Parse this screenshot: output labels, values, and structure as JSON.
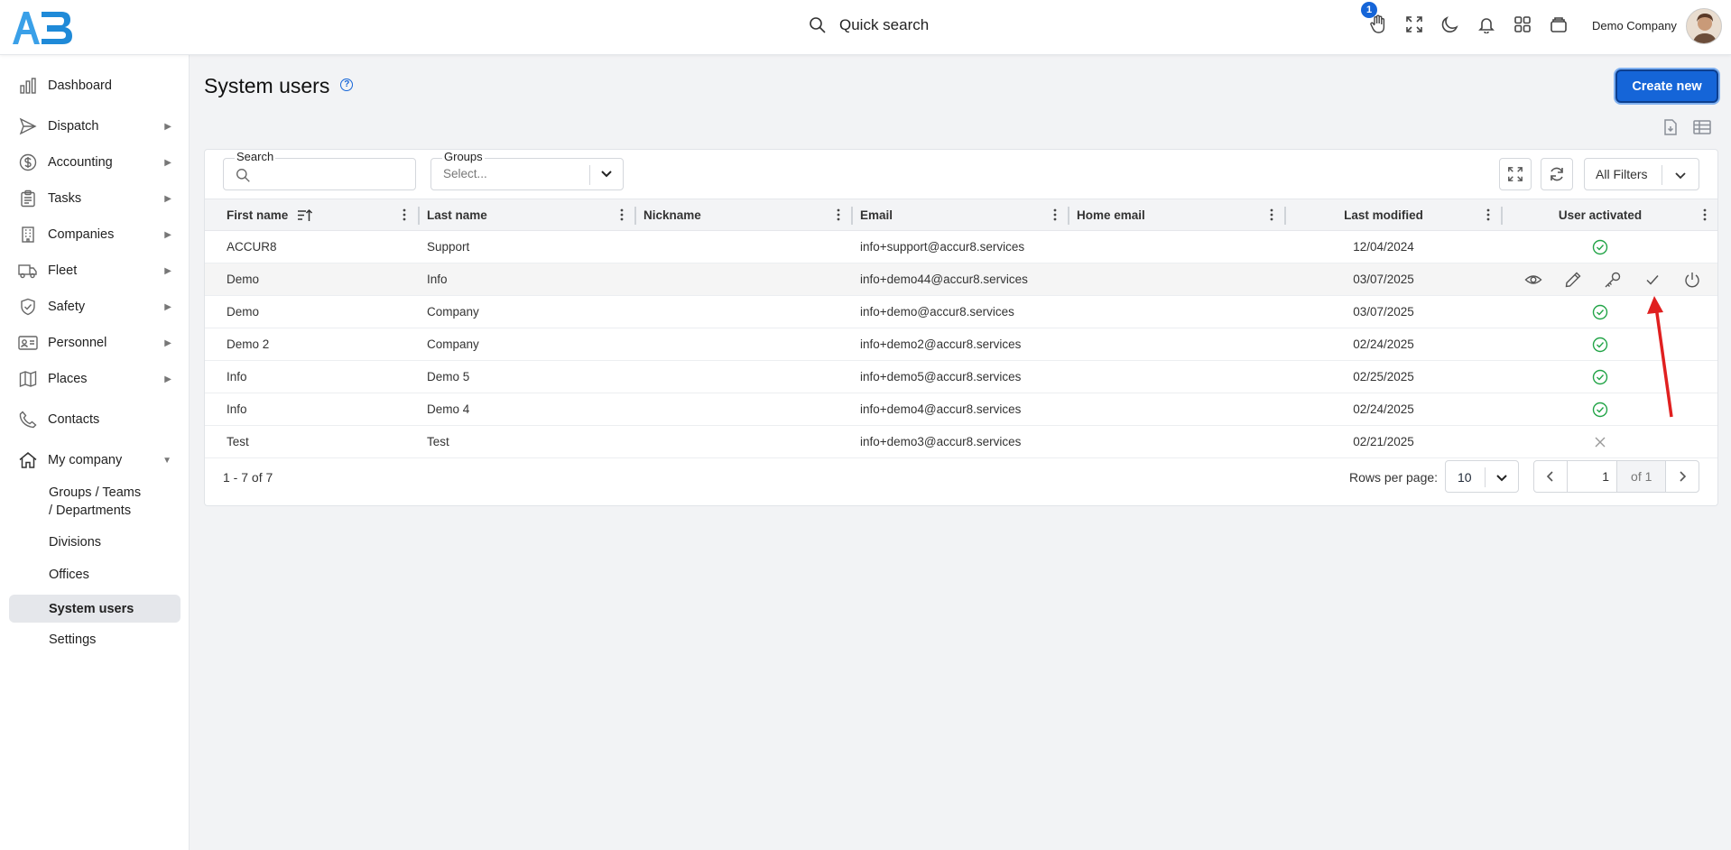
{
  "header": {
    "quick_search": "Quick search",
    "notification_count": "1",
    "company": "Demo Company"
  },
  "sidebar": {
    "items": [
      {
        "label": "Dashboard",
        "icon": "chart-bars-icon",
        "has_arrow": false
      },
      {
        "label": "Dispatch",
        "icon": "send-icon",
        "has_arrow": true
      },
      {
        "label": "Accounting",
        "icon": "dollar-circle-icon",
        "has_arrow": true
      },
      {
        "label": "Tasks",
        "icon": "clipboard-icon",
        "has_arrow": true
      },
      {
        "label": "Companies",
        "icon": "building-icon",
        "has_arrow": true
      },
      {
        "label": "Fleet",
        "icon": "truck-icon",
        "has_arrow": true
      },
      {
        "label": "Safety",
        "icon": "shield-check-icon",
        "has_arrow": true
      },
      {
        "label": "Personnel",
        "icon": "id-card-icon",
        "has_arrow": true
      },
      {
        "label": "Places",
        "icon": "map-icon",
        "has_arrow": true
      },
      {
        "label": "Contacts",
        "icon": "phone-icon",
        "has_arrow": false
      },
      {
        "label": "My company",
        "icon": "home-icon",
        "has_arrow": true
      }
    ],
    "sub_items": [
      {
        "label": "Groups / Teams / Departments"
      },
      {
        "label": "Divisions"
      },
      {
        "label": "Offices"
      },
      {
        "label": "System users",
        "active": true
      },
      {
        "label": "Settings"
      }
    ],
    "arrow_glyph": "▶",
    "arrow_open_glyph": "▼"
  },
  "page": {
    "title": "System users",
    "help_glyph": "?",
    "create_label": "Create new"
  },
  "filters": {
    "search_label": "Search",
    "groups_label": "Groups",
    "groups_placeholder": "Select...",
    "all_filters_label": "All Filters"
  },
  "table": {
    "columns": [
      "First name",
      "Last name",
      "Nickname",
      "Email",
      "Home email",
      "Last modified",
      "User activated"
    ],
    "rows": [
      {
        "first": "ACCUR8",
        "last": "Support",
        "nickname": "",
        "email": "info+support@accur8.services",
        "home_email": "",
        "modified": "12/04/2024",
        "activated": true
      },
      {
        "first": "Demo",
        "last": "Info",
        "nickname": "",
        "email": "info+demo44@accur8.services",
        "home_email": "",
        "modified": "03/07/2025",
        "activated": true
      },
      {
        "first": "Demo",
        "last": "Company",
        "nickname": "",
        "email": "info+demo@accur8.services",
        "home_email": "",
        "modified": "03/07/2025",
        "activated": true
      },
      {
        "first": "Demo 2",
        "last": "Company",
        "nickname": "",
        "email": "info+demo2@accur8.services",
        "home_email": "",
        "modified": "02/24/2025",
        "activated": true
      },
      {
        "first": "Info",
        "last": "Demo 5",
        "nickname": "",
        "email": "info+demo5@accur8.services",
        "home_email": "",
        "modified": "02/25/2025",
        "activated": true
      },
      {
        "first": "Info",
        "last": "Demo 4",
        "nickname": "",
        "email": "info+demo4@accur8.services",
        "home_email": "",
        "modified": "02/24/2025",
        "activated": true
      },
      {
        "first": "Test",
        "last": "Test",
        "nickname": "",
        "email": "info+demo3@accur8.services",
        "home_email": "",
        "modified": "02/21/2025",
        "activated": false
      }
    ],
    "hover_row_index": 1
  },
  "pagination": {
    "summary": "1 - 7 of 7",
    "rows_per_page_label": "Rows per page:",
    "rows_per_page": "10",
    "current_page": "1",
    "of_label": "of 1"
  },
  "colors": {
    "accent": "#1565d8",
    "success": "#22a447",
    "annotation": "#e02020"
  }
}
